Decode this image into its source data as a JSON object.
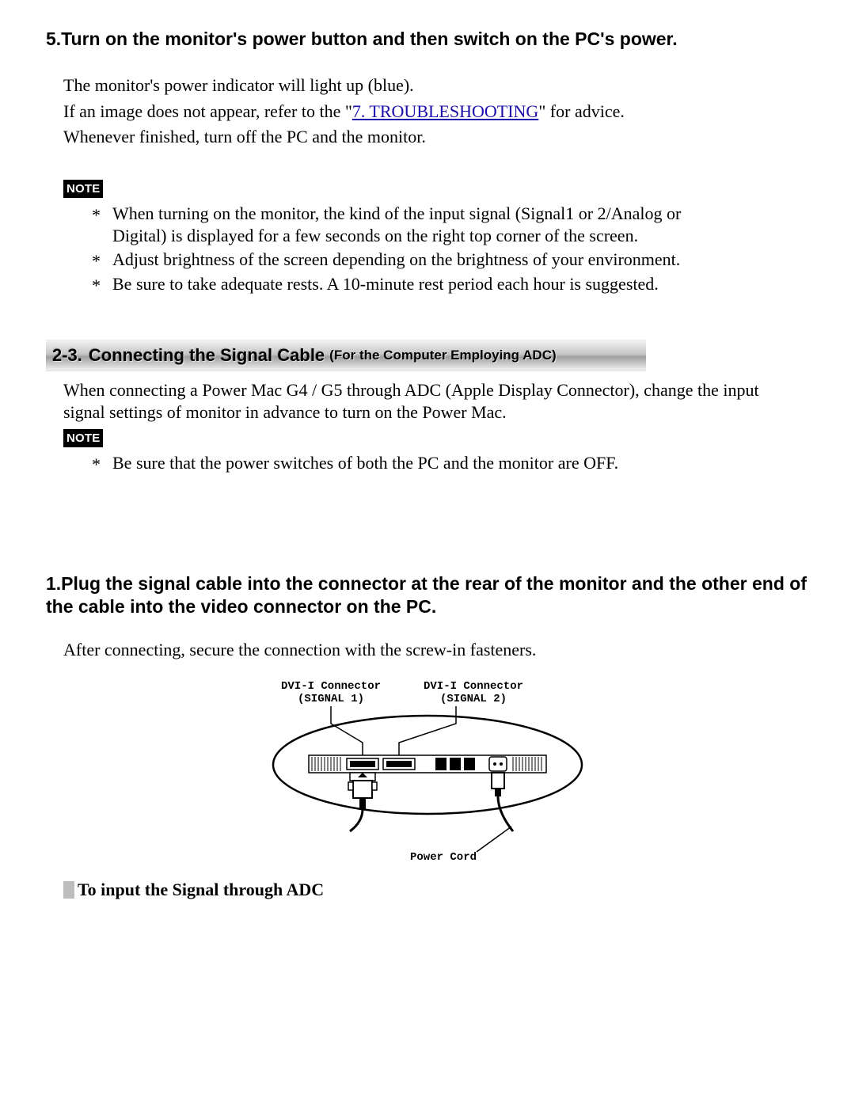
{
  "step5": {
    "heading": "5.Turn on the monitor's power button and then switch on the PC's power.",
    "p1_a": "The monitor's power indicator will light up (blue).",
    "p2_a": "If an image does not appear, refer to the \"",
    "p2_link": "7. TROUBLESHOOTING",
    "p2_b": "\" for advice.",
    "p3": "Whenever finished, turn off the PC and the monitor.",
    "note_label": "NOTE",
    "notes": [
      "When turning on the monitor, the kind of the input signal (Signal1 or 2/Analog or Digital) is displayed for a few seconds on the right top corner of the screen.",
      "Adjust brightness of the screen depending on the brightness of your environment.",
      "Be sure to take adequate rests. A 10-minute rest period each hour is suggested."
    ]
  },
  "section23": {
    "num": "2-3.",
    "title": "Connecting the Signal Cable",
    "subtitle": "(For the Computer Employing ADC)",
    "intro": "When connecting a Power Mac G4 / G5 through ADC (Apple Display Connector), change the input signal settings of monitor in advance to turn on the Power Mac.",
    "note_label": "NOTE",
    "notes": [
      "Be sure that the power switches of both the PC and the monitor are OFF."
    ]
  },
  "step1b": {
    "heading": "1.Plug the signal cable into the connector at the rear of the monitor and the other end of the cable into the video connector on the PC.",
    "p1": "After connecting, secure the connection with the screw-in fasteners."
  },
  "diagram": {
    "label_dvi1_a": "DVI-I Connector",
    "label_dvi1_b": "(SIGNAL 1)",
    "label_dvi2_a": "DVI-I Connector",
    "label_dvi2_b": "(SIGNAL 2)",
    "power_cord": "Power Cord"
  },
  "subhead": {
    "text": "To input the Signal through ADC"
  }
}
